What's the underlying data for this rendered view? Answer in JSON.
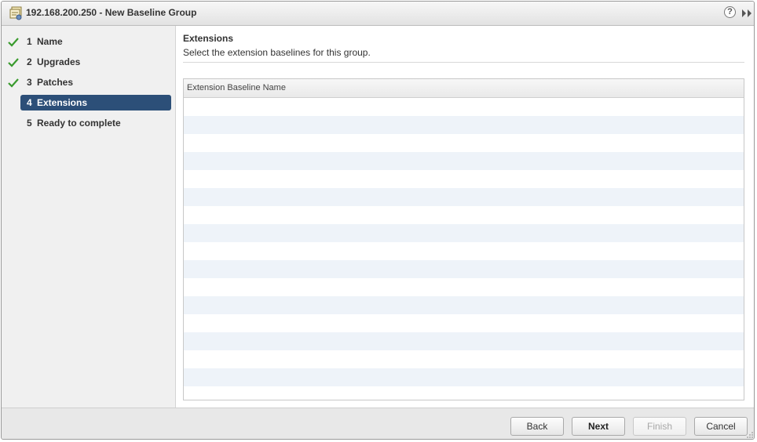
{
  "window": {
    "title": "192.168.200.250 - New Baseline Group",
    "help_glyph": "?"
  },
  "steps": [
    {
      "number": "1",
      "label": "Name",
      "completed": true,
      "active": false
    },
    {
      "number": "2",
      "label": "Upgrades",
      "completed": true,
      "active": false
    },
    {
      "number": "3",
      "label": "Patches",
      "completed": true,
      "active": false
    },
    {
      "number": "4",
      "label": "Extensions",
      "completed": false,
      "active": true
    },
    {
      "number": "5",
      "label": "Ready to complete",
      "completed": false,
      "active": false
    }
  ],
  "content": {
    "title": "Extensions",
    "description": "Select the extension baselines for this group.",
    "table": {
      "columns": [
        "Extension Baseline Name"
      ],
      "rows": []
    }
  },
  "footer": {
    "back_label": "Back",
    "next_label": "Next",
    "finish_label": "Finish",
    "cancel_label": "Cancel"
  },
  "colors": {
    "active_step": "#2c4f78",
    "check": "#3a9b2e",
    "row_stripe": "#eef3f9"
  },
  "icons": {
    "title": "baseline-group-icon",
    "help": "help-icon",
    "expand": "double-chevron-right-icon",
    "step_done": "check-icon"
  }
}
